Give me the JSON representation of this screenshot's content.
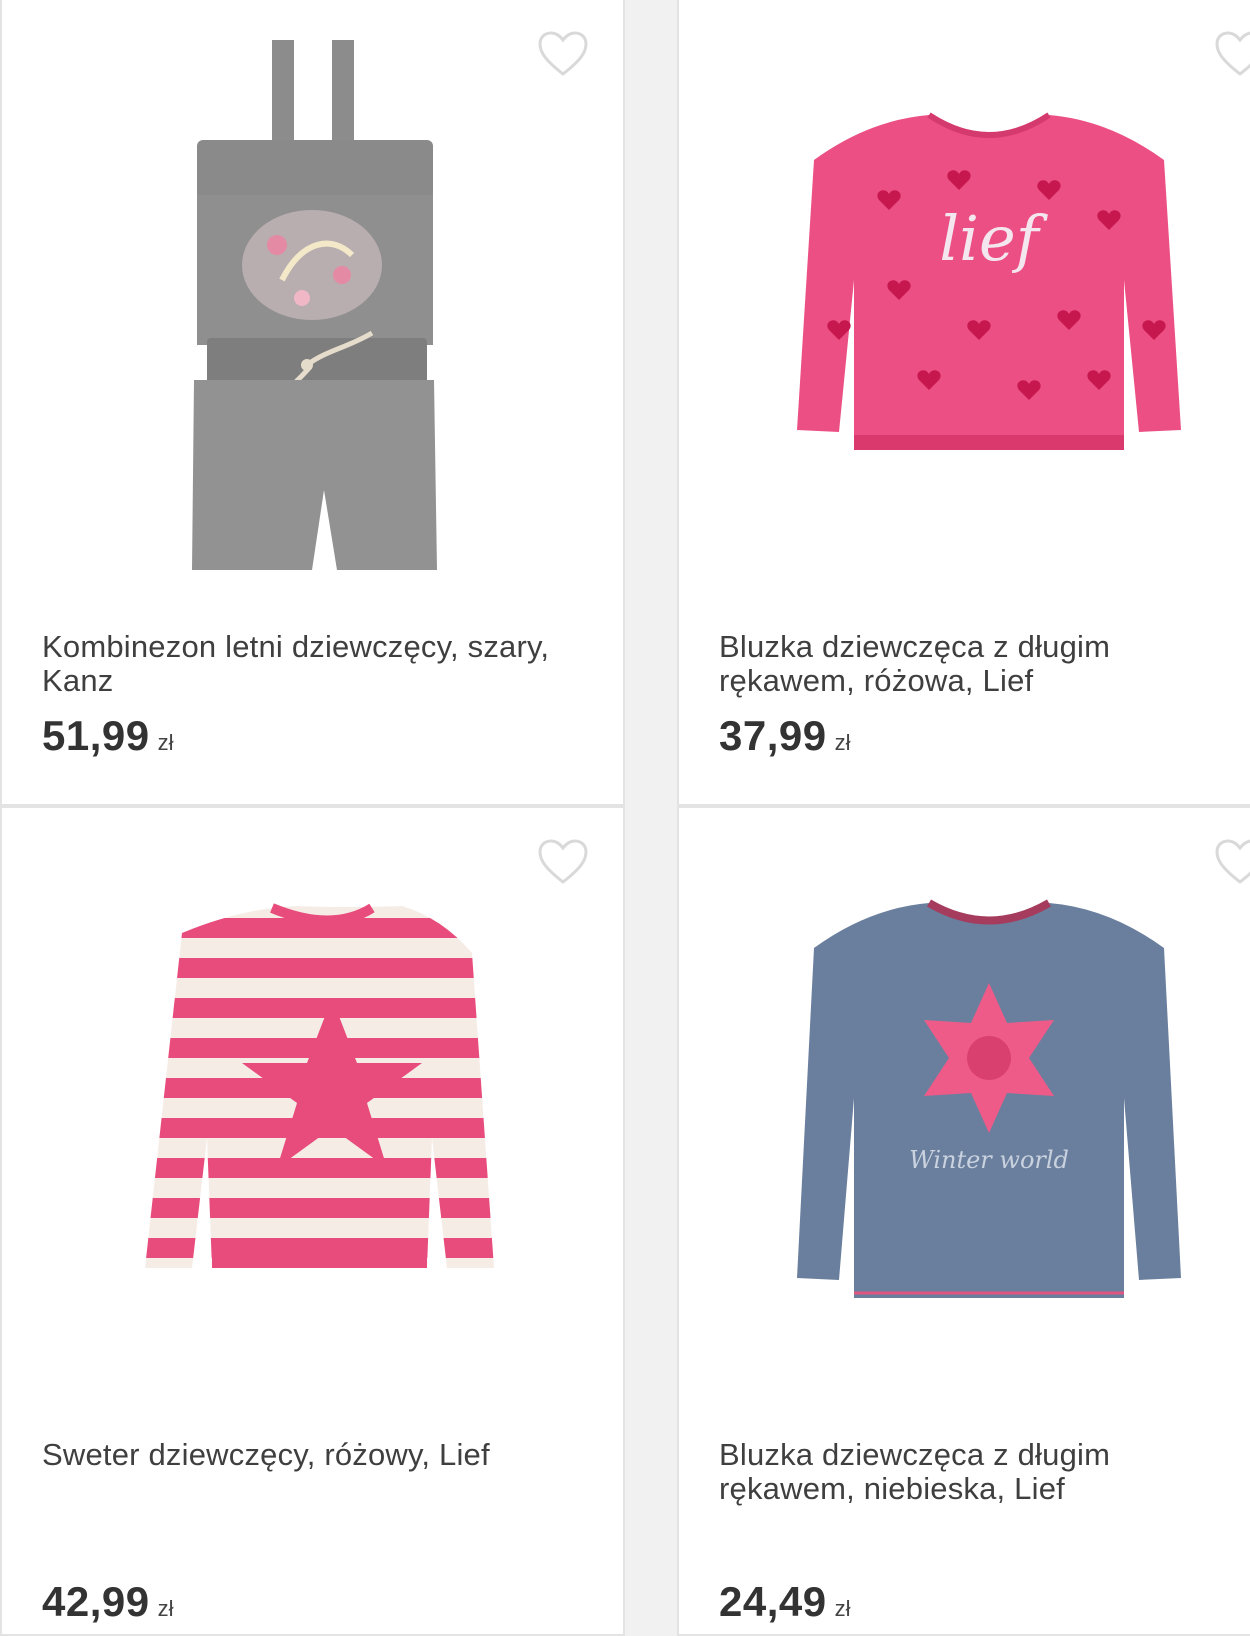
{
  "products": [
    {
      "title": "Kombinezon letni dziewczęcy, szary, Kanz",
      "price": "51,99",
      "currency": "zł",
      "image_icon": "gray-romper-image",
      "color": "#8f8f8f"
    },
    {
      "title": "Bluzka dziewczęca z długim rękawem, różowa, Lief",
      "price": "37,99",
      "currency": "zł",
      "image_icon": "pink-heart-blouse-image",
      "color": "#ec4f84"
    },
    {
      "title": "Sweter dziewczęcy, różowy, Lief",
      "price": "42,99",
      "currency": "zł",
      "image_icon": "pink-striped-sweater-image",
      "color": "#e84c7c"
    },
    {
      "title": "Bluzka dziewczęca z długim rękawem, niebieska, Lief",
      "price": "24,49",
      "currency": "zł",
      "image_icon": "blue-snowflake-blouse-image",
      "color": "#6a7f9e"
    }
  ],
  "garment_print_text": {
    "blouse_pink": "lief",
    "blouse_blue": "Winter world"
  }
}
